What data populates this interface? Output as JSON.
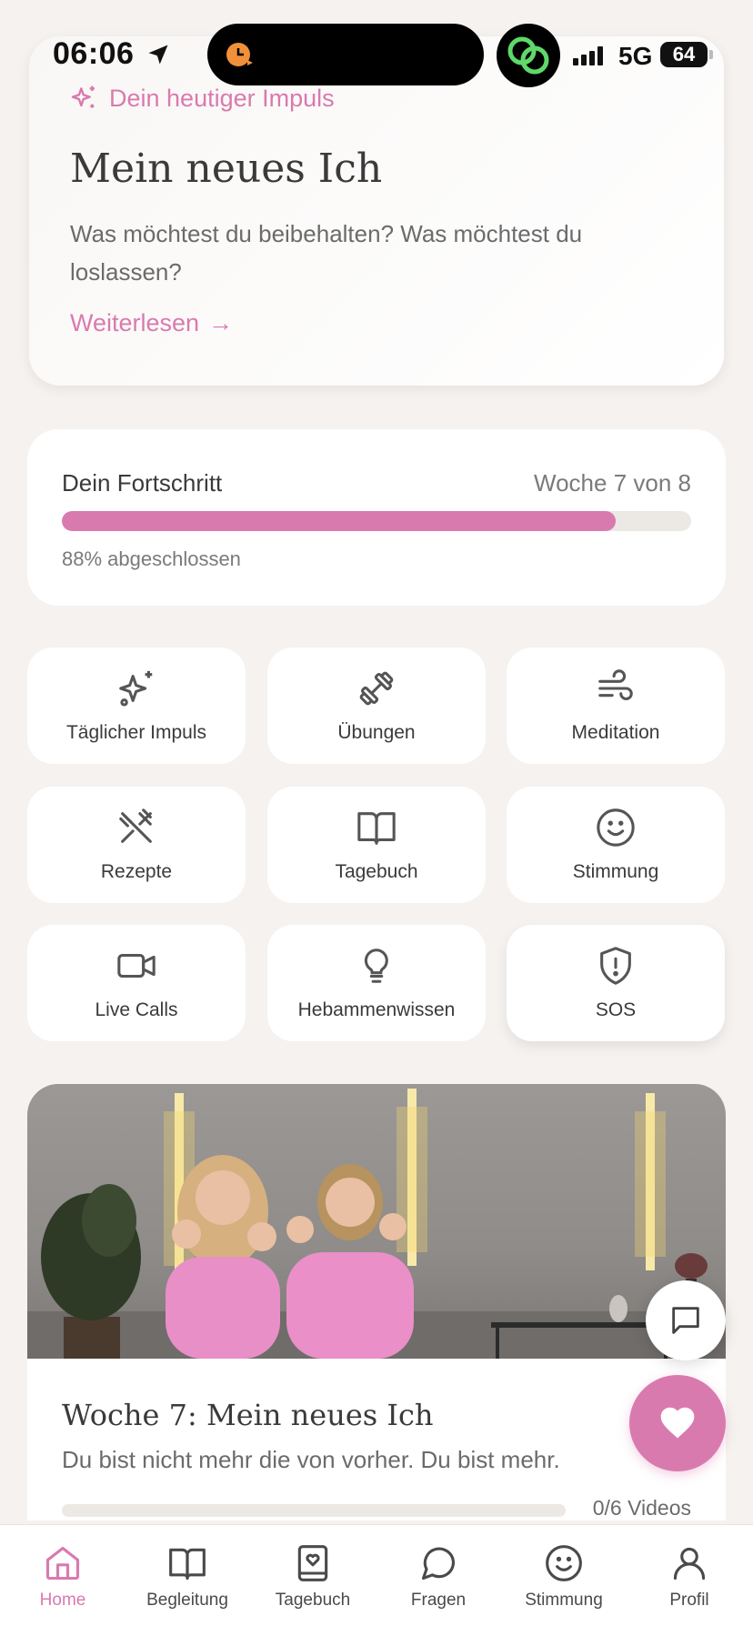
{
  "status_bar": {
    "time": "06:06",
    "network": "5G",
    "battery": "64"
  },
  "impulse": {
    "tag": "Dein heutiger Impuls",
    "title": "Mein neues Ich",
    "text": "Was möchtest du beibehalten? Was möchtest du loslassen?",
    "link": "Weiterlesen",
    "link_arrow": "→"
  },
  "progress": {
    "title": "Dein Fortschritt",
    "week": "Woche 7 von 8",
    "percent": 88,
    "percent_label": "88% abgeschlossen"
  },
  "tiles": [
    {
      "label": "Täglicher Impuls",
      "icon": "sparkles-icon"
    },
    {
      "label": "Übungen",
      "icon": "dumbbell-icon"
    },
    {
      "label": "Meditation",
      "icon": "wind-icon"
    },
    {
      "label": "Rezepte",
      "icon": "utensils-crossed-icon"
    },
    {
      "label": "Tagebuch",
      "icon": "open-book-icon"
    },
    {
      "label": "Stimmung",
      "icon": "smiley-icon"
    },
    {
      "label": "Live Calls",
      "icon": "video-camera-icon"
    },
    {
      "label": "Hebammenwissen",
      "icon": "lightbulb-icon"
    },
    {
      "label": "SOS",
      "icon": "shield-alert-icon"
    }
  ],
  "video": {
    "title": "Woche 7: Mein neues Ich",
    "subtitle": "Du bist nicht mehr die von vorher. Du bist mehr.",
    "count": "0/6 Videos"
  },
  "nav": [
    {
      "label": "Home",
      "icon": "home-icon",
      "active": true
    },
    {
      "label": "Begleitung",
      "icon": "book-icon",
      "active": false
    },
    {
      "label": "Tagebuch",
      "icon": "journal-icon",
      "active": false
    },
    {
      "label": "Fragen",
      "icon": "chat-bubble-icon",
      "active": false
    },
    {
      "label": "Stimmung",
      "icon": "smiley-icon",
      "active": false
    },
    {
      "label": "Profil",
      "icon": "user-icon",
      "active": false
    }
  ],
  "colors": {
    "accent": "#d97aaf",
    "background": "#f5f2ef",
    "text": "#3a3a3a"
  }
}
